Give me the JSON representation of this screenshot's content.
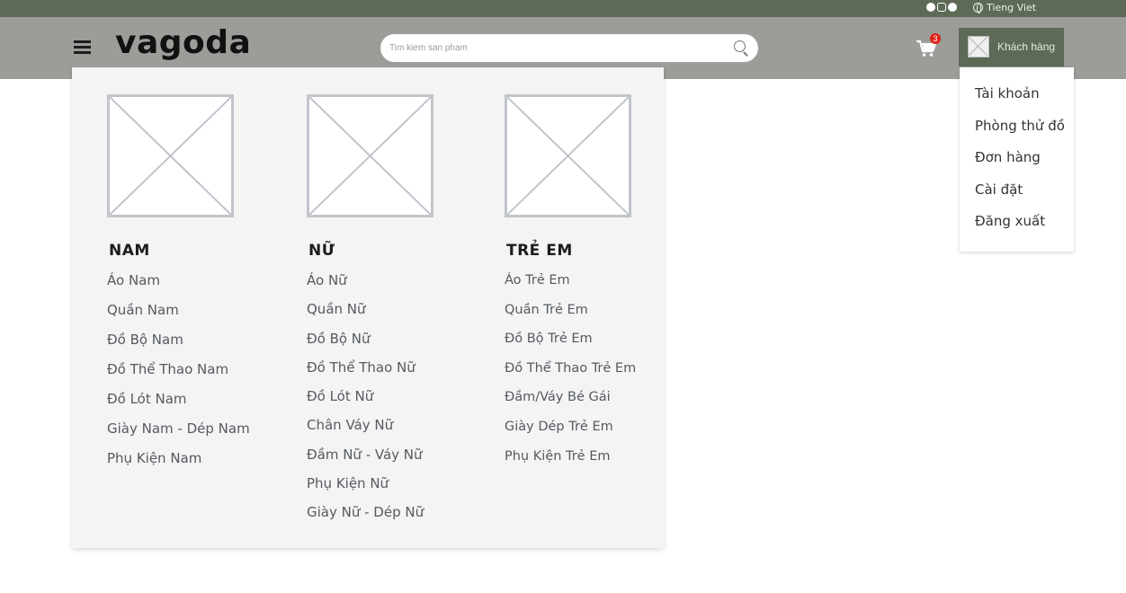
{
  "topbar": {
    "social_icons": [
      "facebook-icon",
      "instagram-icon",
      "pinterest-icon"
    ],
    "language": "Tieng Viet"
  },
  "header": {
    "logo": "vagoda",
    "search_placeholder": "Tim kiem san pham",
    "cart_count": "3",
    "account_label": "Khách hàng"
  },
  "mega_menu": {
    "columns": [
      {
        "title": "NAM",
        "items": [
          "Áo Nam",
          "Quần Nam",
          "Đồ Bộ Nam",
          "Đồ Thể Thao Nam",
          "Đồ Lót Nam",
          "Giày Nam - Dép Nam",
          "Phụ Kiện Nam"
        ]
      },
      {
        "title": "NỮ",
        "items": [
          "Áo Nữ",
          "Quần Nữ",
          "Đồ Bộ Nữ",
          "Đồ Thể Thao Nữ",
          "Đồ Lót Nữ",
          "Chân Váy Nữ",
          "Đầm Nữ - Váy Nữ",
          "Phụ Kiện Nữ",
          "Giày Nữ - Dép Nữ"
        ]
      },
      {
        "title": "TRẺ EM",
        "items": [
          "Áo Trẻ Em",
          "Quần Trẻ Em",
          "Đồ Bộ Trẻ Em",
          "Đồ Thể Thao Trẻ Em",
          "Đầm/Váy Bé Gái",
          "Giày Dép Trẻ Em",
          "Phụ Kiện Trẻ Em"
        ]
      }
    ]
  },
  "account_menu": {
    "items": [
      "Tài khoản",
      "Phòng thử đồ",
      "Đơn hàng",
      "Cài đặt",
      "Đăng xuất"
    ]
  },
  "colors": {
    "topbar": "#5c6a56",
    "header": "#9c9c99",
    "account_button": "#5c6a56",
    "panel": "#f4f4f5",
    "badge": "#e2231a"
  }
}
